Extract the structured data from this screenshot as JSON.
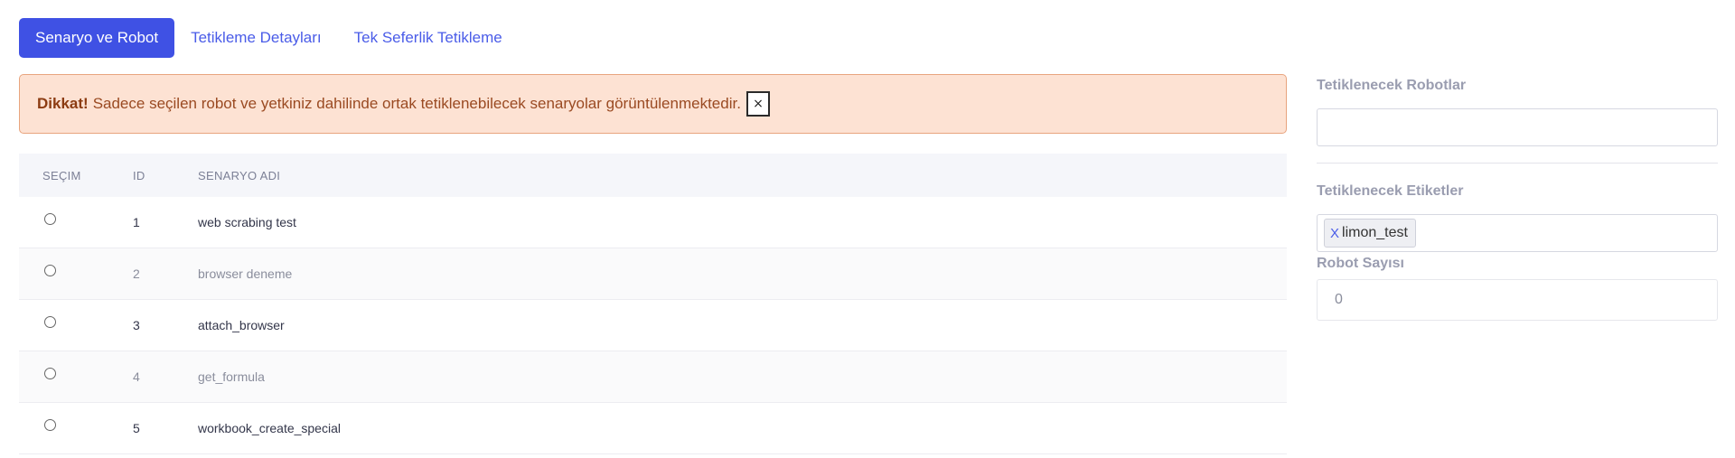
{
  "tabs": [
    {
      "label": "Senaryo ve Robot",
      "active": true
    },
    {
      "label": "Tetikleme Detayları",
      "active": false
    },
    {
      "label": "Tek Seferlik Tetikleme",
      "active": false
    }
  ],
  "alert": {
    "title": "Dikkat!",
    "message": "Sadece seçilen robot ve yetkiniz dahilinde ortak tetiklenebilecek senaryolar görüntülenmektedir.",
    "close_label": "×"
  },
  "table": {
    "headers": [
      "SEÇIM",
      "ID",
      "SENARYO ADI"
    ],
    "rows": [
      {
        "id": "1",
        "name": "web scrabing test"
      },
      {
        "id": "2",
        "name": "browser deneme"
      },
      {
        "id": "3",
        "name": "attach_browser"
      },
      {
        "id": "4",
        "name": "get_formula"
      },
      {
        "id": "5",
        "name": "workbook_create_special"
      }
    ]
  },
  "right_panel": {
    "robots_label": "Tetiklenecek Robotlar",
    "robots_value": "",
    "tags_label": "Tetiklenecek Etiketler",
    "tags": [
      {
        "remove": "X",
        "label": "limon_test"
      }
    ],
    "robot_count_label": "Robot Sayısı",
    "robot_count_value": "0"
  },
  "colors": {
    "accent": "#3f51e4",
    "alert_bg": "#fde2d3",
    "alert_border": "#e8a47e"
  }
}
